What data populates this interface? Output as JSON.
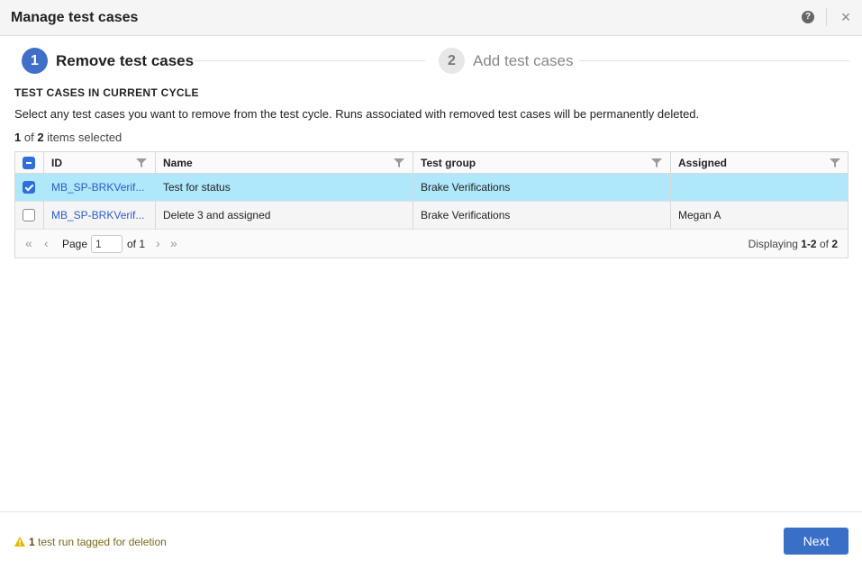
{
  "dialog": {
    "title": "Manage test cases",
    "help_icon": "question-circle-icon",
    "close_icon": "close-icon"
  },
  "steps": [
    {
      "number": "1",
      "label": "Remove test cases",
      "active": true
    },
    {
      "number": "2",
      "label": "Add test cases",
      "active": false
    }
  ],
  "section": {
    "title": "TEST CASES IN CURRENT CYCLE",
    "description": "Select any test cases you want to remove from the test cycle. Runs associated with removed test cases will be permanently deleted."
  },
  "selection": {
    "selected": "1",
    "of_text": "of",
    "total": "2",
    "suffix": "items selected"
  },
  "table": {
    "columns": [
      "ID",
      "Name",
      "Test group",
      "Assigned"
    ],
    "rows": [
      {
        "selected": true,
        "id": "MB_SP-BRKVerif...",
        "name": "Test for status",
        "test_group": "Brake Verifications",
        "assigned": ""
      },
      {
        "selected": false,
        "id": "MB_SP-BRKVerif...",
        "name": "Delete 3 and assigned",
        "test_group": "Brake Verifications",
        "assigned": "Megan A"
      }
    ]
  },
  "pager": {
    "page_label": "Page",
    "page_value": "1",
    "of_label": "of 1",
    "display_prefix": "Displaying",
    "display_range": "1-2",
    "display_of": "of",
    "display_total": "2"
  },
  "footer": {
    "warning_count": "1",
    "warning_text": "test run tagged for deletion",
    "next_label": "Next"
  },
  "colors": {
    "accent": "#3f6fc6",
    "selected_row": "#aee8fa",
    "link": "#2c5cc5",
    "warning": "#e6b800"
  }
}
